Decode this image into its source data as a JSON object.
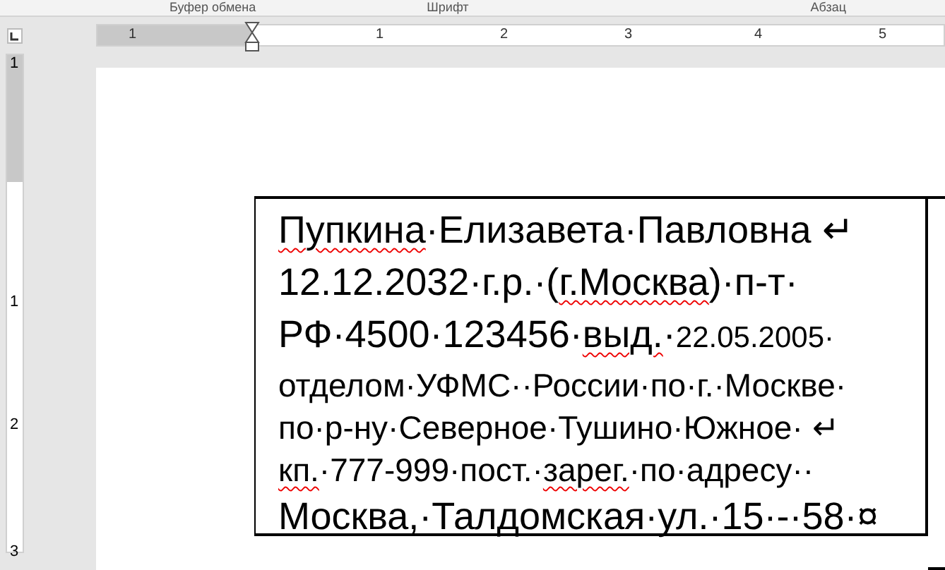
{
  "ribbon_groups": [
    {
      "label": "Буфер обмена"
    },
    {
      "label": "Шрифт"
    },
    {
      "label": "Абзац"
    }
  ],
  "horizontal_ruler": {
    "labels": [
      "1",
      "1",
      "2",
      "3",
      "4",
      "5"
    ]
  },
  "vertical_ruler": {
    "labels": [
      "1",
      "1",
      "2",
      "3"
    ]
  },
  "table": {
    "cell_lines": [
      {
        "kind": "large",
        "segments": [
          {
            "text": "Пупкина",
            "misspelled": true
          },
          {
            "text": "·Елизавета·Павловна ↵",
            "misspelled": false
          }
        ]
      },
      {
        "kind": "large",
        "segments": [
          {
            "text": "12.12.2032·г.р.·(",
            "misspelled": false
          },
          {
            "text": "г.Москва",
            "misspelled": true
          },
          {
            "text": ")·п-т·",
            "misspelled": false
          }
        ]
      },
      {
        "kind": "large",
        "segments": [
          {
            "text": "РФ·4500·123456·",
            "misspelled": false
          },
          {
            "text": "выд.",
            "misspelled": true
          },
          {
            "text": "·",
            "misspelled": false
          },
          {
            "text": "22.05.2005·",
            "misspelled": false,
            "small": true
          }
        ]
      },
      {
        "kind": "medium",
        "segments": [
          {
            "text": "отделом·УФМС··России·по·г.·Москве·",
            "misspelled": false
          }
        ]
      },
      {
        "kind": "medium",
        "segments": [
          {
            "text": "по·р-ну·Северное·Тушино·Южное· ↵",
            "misspelled": false
          }
        ]
      },
      {
        "kind": "medium",
        "segments": [
          {
            "text": "кп.",
            "misspelled": true
          },
          {
            "text": "·777-999·пост.·",
            "misspelled": false
          },
          {
            "text": "зарег.",
            "misspelled": true
          },
          {
            "text": "·по·адресу··",
            "misspelled": false
          }
        ]
      },
      {
        "kind": "large",
        "segments": [
          {
            "text": "Москва,·Талдомская·ул.·15·-·58·¤",
            "misspelled": false
          }
        ]
      }
    ]
  }
}
